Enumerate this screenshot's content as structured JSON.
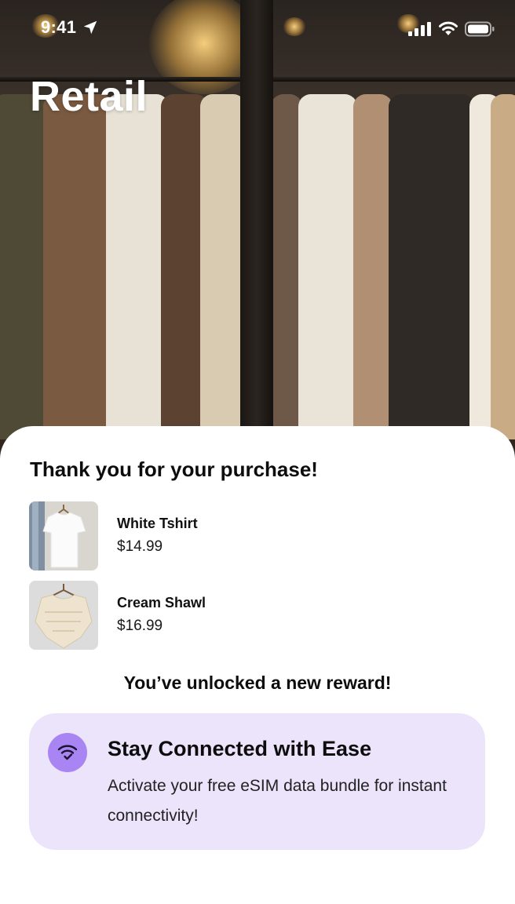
{
  "status_bar": {
    "time": "9:41",
    "icons": [
      "location-arrow-icon",
      "cellular-signal-icon",
      "wifi-icon",
      "battery-icon"
    ]
  },
  "header": {
    "title": "Retail",
    "background": "clothing-rack-photo"
  },
  "sheet": {
    "heading": "Thank you for your purchase!",
    "items": [
      {
        "name": "White Tshirt",
        "price": "$14.99",
        "thumbnail": "white-tshirt-on-hanger"
      },
      {
        "name": "Cream Shawl",
        "price": "$16.99",
        "thumbnail": "cream-knit-shawl-on-hanger"
      }
    ],
    "reward_heading": "You’ve unlocked a new reward!",
    "reward_card": {
      "icon": "wifi-check-icon",
      "title": "Stay Connected with Ease",
      "body": "Activate your free eSIM data bundle for instant connectivity!"
    }
  },
  "colors": {
    "sheet_background": "#ffffff",
    "reward_card_background": "#ebe4fb",
    "reward_icon_background": "#a985f4",
    "text_primary": "#0d0d0d"
  }
}
